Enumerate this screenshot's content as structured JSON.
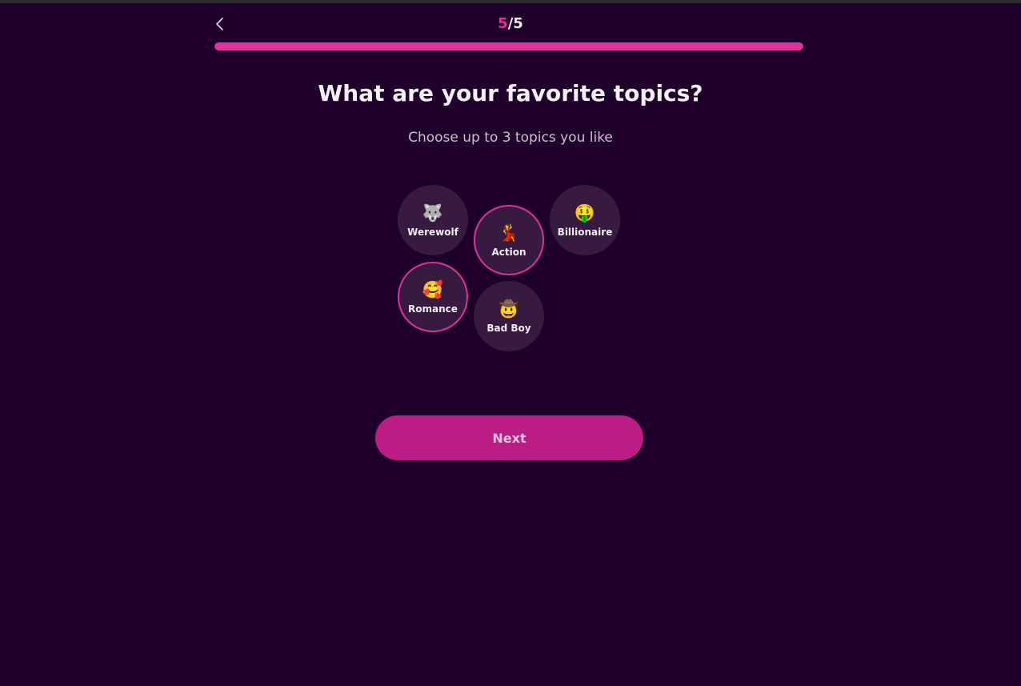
{
  "header": {
    "back_icon": "chevron-left-icon",
    "step_current": "5",
    "step_total": "/5",
    "progress_fraction": 1.0
  },
  "main": {
    "title": "What are your favorite topics?",
    "subtitle": "Choose up to 3 topics you like",
    "topics": [
      {
        "label": "Werewolf",
        "emoji": "🐺",
        "icon": "wolf-icon",
        "selected": false
      },
      {
        "label": "Action",
        "emoji": "💃",
        "icon": "dancer-icon",
        "selected": true
      },
      {
        "label": "Billionaire",
        "emoji": "🤑",
        "icon": "money-mouth-face-icon",
        "selected": false
      },
      {
        "label": "Romance",
        "emoji": "🥰",
        "icon": "smiling-face-with-hearts-icon",
        "selected": true
      },
      {
        "label": "Bad Boy",
        "emoji": "🤠",
        "icon": "cowboy-face-icon",
        "selected": false
      }
    ],
    "next_label": "Next"
  },
  "colors": {
    "background": "#1f002b",
    "accent": "#e0329a",
    "button": "#bb1d84",
    "bubble": "#361a40"
  }
}
